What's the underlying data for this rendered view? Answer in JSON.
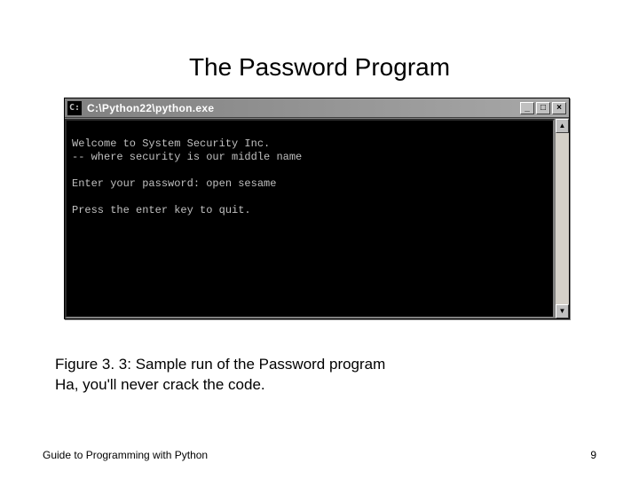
{
  "slide": {
    "title": "The Password Program",
    "caption_line1": "Figure 3. 3: Sample run of the Password program",
    "caption_line2": "Ha, you'll never crack the code."
  },
  "window": {
    "title": "C:\\Python22\\python.exe",
    "minimize": "_",
    "maximize": "□",
    "close": "×",
    "scroll_up": "▲",
    "scroll_down": "▼"
  },
  "console": {
    "line1": "Welcome to System Security Inc.",
    "line2": "-- where security is our middle name",
    "line3": "Enter your password: open sesame",
    "line4": "Press the enter key to quit."
  },
  "footer": {
    "left": "Guide to Programming with Python",
    "right": "9"
  }
}
